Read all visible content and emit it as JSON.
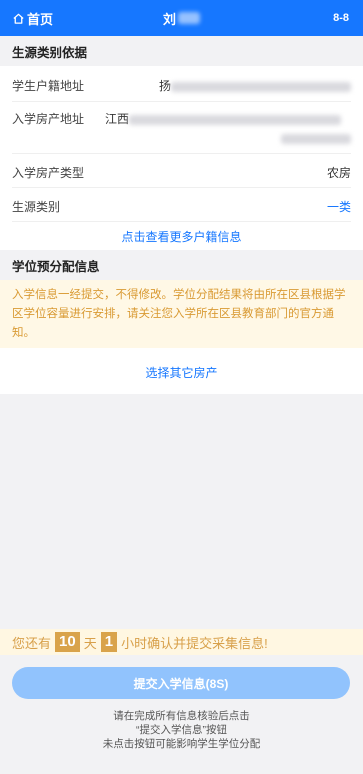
{
  "topbar": {
    "home_label": "首页",
    "title": "刘",
    "code": "8-8"
  },
  "section1": {
    "title": "生源类别依据",
    "rows": [
      {
        "label": "学生户籍地址",
        "value": "扬"
      },
      {
        "label": "入学房产地址",
        "value": "江西"
      },
      {
        "label": "入学房产类型",
        "value": "农房"
      },
      {
        "label": "生源类别",
        "value": "一类"
      }
    ],
    "more_link": "点击查看更多户籍信息"
  },
  "section2": {
    "title": "学位预分配信息",
    "notice": "入学信息一经提交，不得修改。学位分配结果将由所在区县根据学区学位容量进行安排，请关注您入学所在区县教育部门的官方通知。",
    "choose_link": "选择其它房产"
  },
  "countdown": {
    "prefix": "您还有",
    "days": "10",
    "day_unit": "天",
    "hours": "1",
    "suffix": "小时确认并提交采集信息!"
  },
  "submit": {
    "label": "提交入学信息(8S)"
  },
  "hint": {
    "line1": "请在完成所有信息核验后点击",
    "line2": "“提交入学信息”按钮",
    "line3": "未点击按钮可能影响学生学位分配"
  },
  "colors": {
    "primary": "#1677ff",
    "button_disabled": "#91c3fd",
    "notice_text": "#d99a33",
    "countdown_badge": "#d9a34b"
  }
}
